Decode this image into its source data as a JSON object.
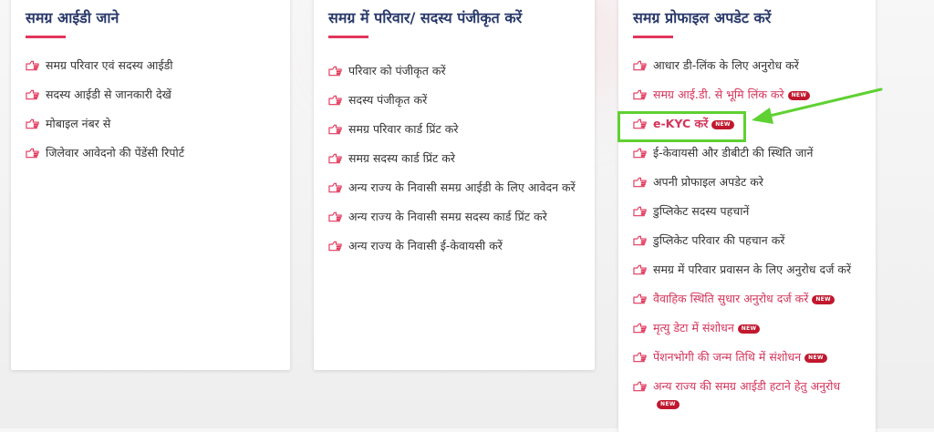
{
  "colors": {
    "accent": "#e2365a",
    "title": "#2a3a6b",
    "link_pink": "#d3345a",
    "highlight_green": "#5fd132",
    "badge": "#c0182e"
  },
  "cards": [
    {
      "title": "समग्र आईडी जाने",
      "items": [
        {
          "label": "समग्र परिवार एवं सदस्य आईडी"
        },
        {
          "label": "सदस्य आईडी से जानकारी देखें"
        },
        {
          "label": "मोबाइल नंबर से"
        },
        {
          "label": "जिलेवार आवेदनो की पेंडेंसी रिपोर्ट"
        }
      ]
    },
    {
      "title": "समग्र में परिवार/ सदस्य पंजीकृत करें",
      "items": [
        {
          "label": "परिवार को पंजीकृत करें"
        },
        {
          "label": "सदस्य पंजीकृत करें"
        },
        {
          "label": "समग्र परिवार कार्ड प्रिंट करे"
        },
        {
          "label": "समग्र सदस्य कार्ड प्रिंट करे"
        },
        {
          "label": "अन्य राज्य के निवासी समग्र आईडी के लिए आवेदन करें"
        },
        {
          "label": "अन्य राज्य के निवासी समग्र सदस्य कार्ड प्रिंट करे"
        },
        {
          "label": "अन्य राज्य के निवासी ई-केवायसी करें"
        }
      ]
    },
    {
      "title": "समग्र प्रोफाइल अपडेट करें",
      "items": [
        {
          "label": "आधार डी-लिंक के लिए अनुरोध करें"
        },
        {
          "label": "समग्र आई.डी. से भूमि लिंक करे",
          "badge": "NEW"
        },
        {
          "label": "e-KYC करें",
          "badge": "NEW"
        },
        {
          "label": "ई-केवायसी और डीबीटी की स्थिति जानें"
        },
        {
          "label": "अपनी प्रोफाइल अपडेट करे"
        },
        {
          "label": "डुप्लिकेट सदस्य पहचानें"
        },
        {
          "label": "डुप्लिकेट परिवार की पहचान करें"
        },
        {
          "label": "समग्र में परिवार प्रवासन के लिए अनुरोध दर्ज करें"
        },
        {
          "label": "वैवाहिक स्थिति सुधार अनुरोध दर्ज करें",
          "badge": "NEW"
        },
        {
          "label": "मृत्यु डेटा में संशोधन",
          "badge": "NEW"
        },
        {
          "label": "पेंशनभोगी की जन्म तिथि में संशोधन",
          "badge": "NEW"
        },
        {
          "label": "अन्य राज्य की समग्र आईडी हटाने हेतु अनुरोध",
          "badge": "NEW"
        }
      ]
    }
  ]
}
